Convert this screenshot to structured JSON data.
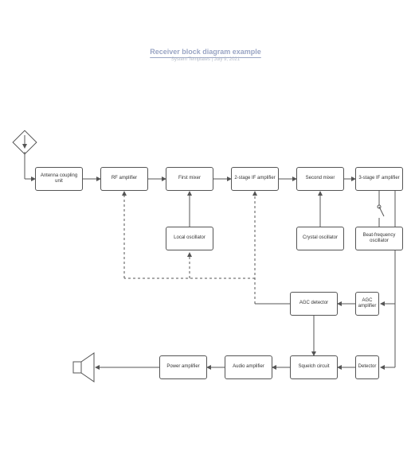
{
  "header": {
    "title": "Receiver block diagram example",
    "subtitle": "System Templates  |  July 9, 2021"
  },
  "blocks": {
    "antenna": "Antenna coupling unit",
    "rf": "RF amplifier",
    "mixer1": "First mixer",
    "if1": "2-stage IF amplifier",
    "mixer2": "Second mixer",
    "if2": "3-stage IF amplifier",
    "lo": "Local oscillator",
    "xo": "Crystal oscillator",
    "bfo": "Beat-frequency oscillator",
    "agcdet": "AGC detector",
    "agcamp": "AGC amplifier",
    "power": "Power amplifier",
    "audio": "Audio amplifier",
    "squelch": "Squelch circuit",
    "detector": "Detector"
  }
}
